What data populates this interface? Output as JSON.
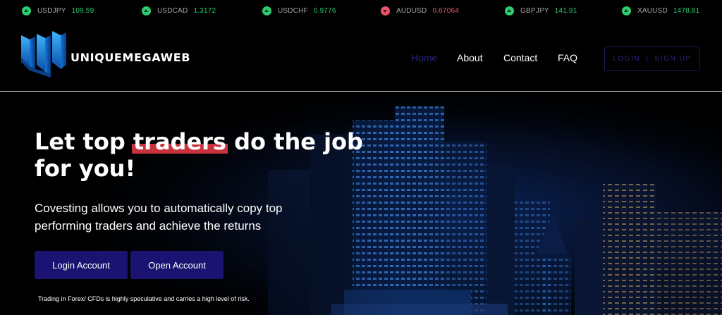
{
  "ticker": [
    {
      "symbol": "USDJPY",
      "price": "109.59",
      "direction": "up"
    },
    {
      "symbol": "USDCAD",
      "price": "1.3172",
      "direction": "up"
    },
    {
      "symbol": "USDCHF",
      "price": "0.9776",
      "direction": "up"
    },
    {
      "symbol": "AUDUSD",
      "price": "0.67064",
      "direction": "down"
    },
    {
      "symbol": "GBPJPY",
      "price": "141.91",
      "direction": "up"
    },
    {
      "symbol": "XAUUSD",
      "price": "1478.81",
      "direction": "up"
    }
  ],
  "colors": {
    "up": "#2ecc71",
    "down": "#e8546b",
    "accent": "#1a1372",
    "highlight": "#c8333d"
  },
  "header": {
    "logo_text": "UNIQUEMEGAWEB",
    "nav": [
      "Home",
      "About",
      "Contact",
      "FAQ"
    ],
    "active_nav": "Home",
    "login_label": "LOGIN",
    "separator": "|",
    "signup_label": "SIGN UP"
  },
  "hero": {
    "headline_pre": "Let top ",
    "headline_highlight": "traders",
    "headline_post": " do the job for you!",
    "subtext": "Covesting allows you to automatically copy top performing traders and achieve the returns",
    "login_button": "Login Account",
    "open_button": "Open Account",
    "disclaimer": "Trading in Forex/ CFDs is highly speculative and carries a high level of risk."
  }
}
